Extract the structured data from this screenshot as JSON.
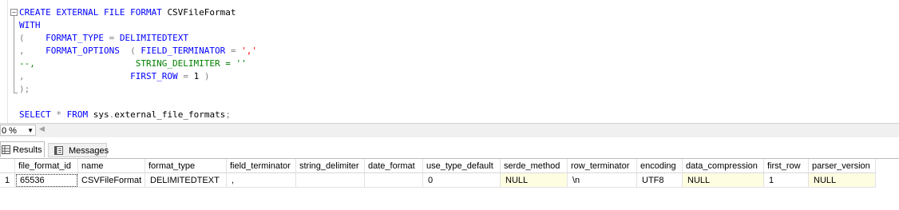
{
  "editor": {
    "lines": [
      [
        {
          "t": "CREATE EXTERNAL FILE FORMAT ",
          "c": "kw"
        },
        {
          "t": "CSVFileFormat",
          "c": "tx"
        }
      ],
      [
        {
          "t": "WITH",
          "c": "kw"
        }
      ],
      [
        {
          "t": "(",
          "c": "gr"
        },
        {
          "t": "    FORMAT_TYPE ",
          "c": "kw"
        },
        {
          "t": "= ",
          "c": "gr"
        },
        {
          "t": "DELIMITEDTEXT",
          "c": "kw"
        }
      ],
      [
        {
          "t": ",",
          "c": "gr"
        },
        {
          "t": "    FORMAT_OPTIONS  ",
          "c": "kw"
        },
        {
          "t": "( ",
          "c": "gr"
        },
        {
          "t": "FIELD_TERMINATOR ",
          "c": "kw"
        },
        {
          "t": "= ",
          "c": "gr"
        },
        {
          "t": "','",
          "c": "str"
        }
      ],
      [
        {
          "t": "--,                   STRING_DELIMITER = ''",
          "c": "cm"
        }
      ],
      [
        {
          "t": ",",
          "c": "gr"
        },
        {
          "t": "                    FIRST_ROW ",
          "c": "kw"
        },
        {
          "t": "= ",
          "c": "gr"
        },
        {
          "t": "1 ",
          "c": "tx"
        },
        {
          "t": ")",
          "c": "gr"
        }
      ],
      [
        {
          "t": ");",
          "c": "gr"
        }
      ],
      [],
      [
        {
          "t": "SELECT ",
          "c": "kw"
        },
        {
          "t": "* ",
          "c": "gr"
        },
        {
          "t": "FROM ",
          "c": "kw"
        },
        {
          "t": "sys",
          "c": "tx"
        },
        {
          "t": ".",
          "c": "gr"
        },
        {
          "t": "external_file_formats",
          "c": "tx"
        },
        {
          "t": ";",
          "c": "gr"
        }
      ]
    ]
  },
  "zoom": {
    "value": "0 %"
  },
  "tabs": {
    "results": "Results",
    "messages": "Messages"
  },
  "results": {
    "columns": [
      "file_format_id",
      "name",
      "format_type",
      "field_terminator",
      "string_delimiter",
      "date_format",
      "use_type_default",
      "serde_method",
      "row_terminator",
      "encoding",
      "data_compression",
      "first_row",
      "parser_version"
    ],
    "rows": [
      {
        "num": "1",
        "cells": [
          "65536",
          "CSVFileFormat",
          "DELIMITEDTEXT",
          ",",
          "",
          "",
          "0",
          "NULL",
          "\\n",
          "UTF8",
          "NULL",
          "1",
          "NULL"
        ]
      }
    ],
    "null_color": "#fffde1"
  }
}
